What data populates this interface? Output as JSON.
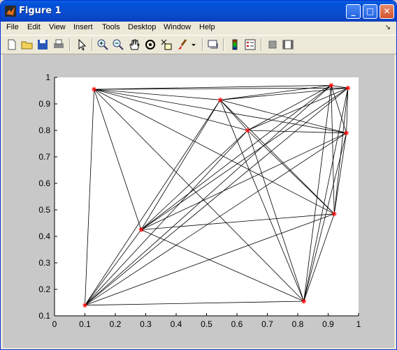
{
  "window": {
    "title": "Figure 1"
  },
  "menu": [
    "File",
    "Edit",
    "View",
    "Insert",
    "Tools",
    "Desktop",
    "Window",
    "Help"
  ],
  "toolbar": [
    "new-figure-icon",
    "open-file-icon",
    "save-icon",
    "print-icon",
    "select-arrow-icon",
    "zoom-in-icon",
    "zoom-out-icon",
    "pan-hand-icon",
    "rotate-3d-icon",
    "data-cursor-icon",
    "brush-icon",
    "brush-dropdown-icon",
    "link-plot-icon",
    "colorbar-icon",
    "legend-icon",
    "hide-plot-tools-icon",
    "show-plot-tools-icon"
  ],
  "colors": {
    "marker": "#ff0000",
    "line": "#000000",
    "axes_bg": "#ffffff",
    "figure_bg": "#c8c8c8"
  },
  "chart_data": {
    "type": "line",
    "title": "",
    "xlabel": "",
    "ylabel": "",
    "xlim": [
      0,
      1
    ],
    "ylim": [
      0.1,
      1
    ],
    "xticks": [
      "0",
      "0.1",
      "0.2",
      "0.3",
      "0.4",
      "0.5",
      "0.6",
      "0.7",
      "0.8",
      "0.9",
      "1"
    ],
    "yticks": [
      "0.1",
      "0.2",
      "0.3",
      "0.4",
      "0.5",
      "0.6",
      "0.7",
      "0.8",
      "0.9",
      "1"
    ],
    "grid": false,
    "description": "complete graph: every node connected to every other node",
    "nodes": [
      {
        "x": 0.13,
        "y": 0.955
      },
      {
        "x": 0.545,
        "y": 0.915
      },
      {
        "x": 0.635,
        "y": 0.8
      },
      {
        "x": 0.91,
        "y": 0.97
      },
      {
        "x": 0.965,
        "y": 0.96
      },
      {
        "x": 0.96,
        "y": 0.79
      },
      {
        "x": 0.92,
        "y": 0.485
      },
      {
        "x": 0.285,
        "y": 0.425
      },
      {
        "x": 0.1,
        "y": 0.14
      },
      {
        "x": 0.82,
        "y": 0.155
      }
    ]
  }
}
